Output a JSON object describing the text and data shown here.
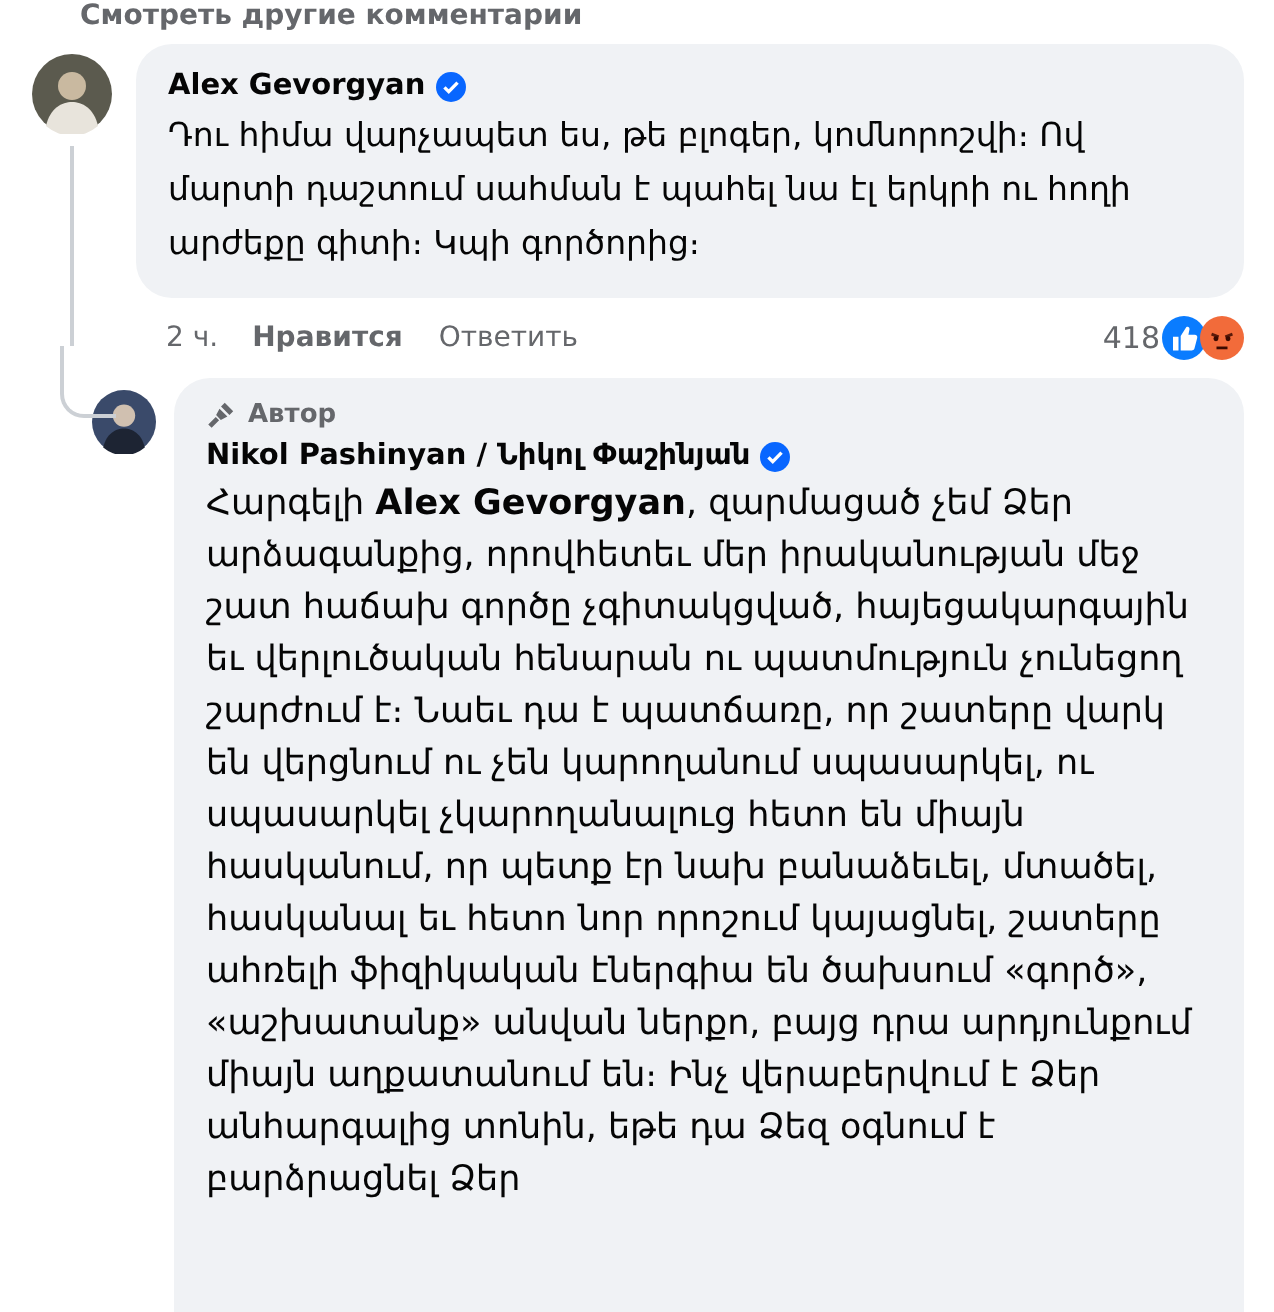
{
  "more_comments": "Смотреть другие комментарии",
  "comment": {
    "author": "Alex Gevorgyan",
    "verified": true,
    "text": "Դու հիմա վարչապետ ես, թե բլոգեր, կոմնորոշվի։ Ով մարտի դաշտում սահման է պահել նա էլ երկրի ու հողի արժեքը գիտի։ Կպի գործորից։",
    "time": "2 ч.",
    "like_label": "Нравится",
    "reply_label": "Ответить",
    "reaction_count": "418",
    "reactions": [
      {
        "kind": "like"
      },
      {
        "kind": "angry"
      }
    ]
  },
  "reply": {
    "badge": "Автор",
    "author": "Nikol Pashinyan / Նիկոլ Փաշինյան",
    "verified": true,
    "text": "Հարգելի **Alex Gevorgyan**, զարմացած չեմ Ձեր արձագանքից, որովհետեւ մեր իրականության մեջ շատ հաճախ գործը չգիտակցված, հայեցակարգային եւ վերլուծական հենարան ու պատմություն չունեցող շարժում է։ Նաեւ դա է պատճառը, որ շատերը վարկ են վերցնում ու չեն կարողանում սպասարկել, ու սպասարկել չկարողանալուց հետո են միայն հասկանում, որ պետք էր նախ բանաձեւել, մտածել, հասկանալ եւ հետո նոր որոշում կայացնել, շատերը ահռելի ֆիզիկական էներգիա են ծախսում «գործ», «աշխատանք» անվան ներքո, բայց դրա արդյունքում միայն աղքատանում են։ Ինչ վերաբերվում է Ձեր անհարգալից տոնին, եթե դա Ձեզ օգնում է բարձրացնել Ձեր"
  }
}
